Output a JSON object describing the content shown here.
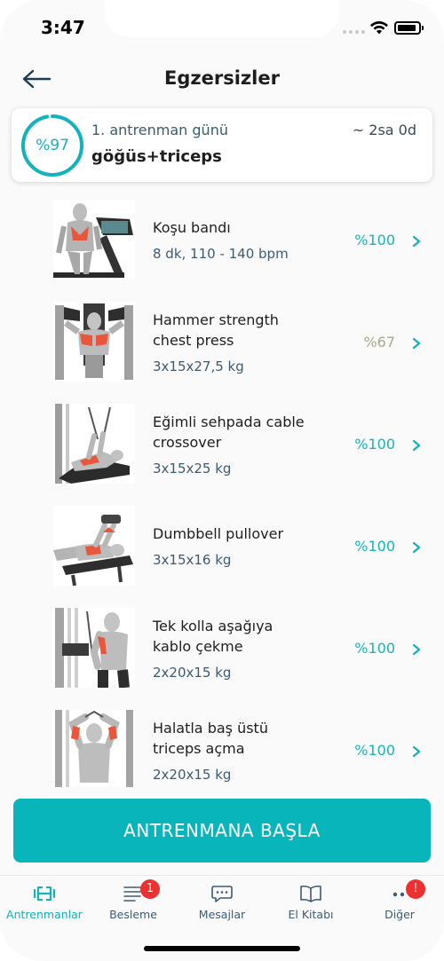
{
  "status_bar": {
    "time": "3:47"
  },
  "header": {
    "title": "Egzersizler"
  },
  "day_card": {
    "progress_label": "%97",
    "progress_value": 0.97,
    "day_label": "1. antrenman günü",
    "duration": "~ 2sa 0d",
    "muscles": "göğüs+triceps"
  },
  "exercises": [
    {
      "name": "Koşu bandı",
      "detail": "8 dk, 110 - 140 bpm",
      "percent": "%100",
      "thumb_icon": "treadmill-icon"
    },
    {
      "name": "Hammer strength chest press",
      "detail": "3x15x27,5 kg",
      "percent": "%67",
      "thumb_icon": "chest-press-icon"
    },
    {
      "name": "Eğimli sehpada cable crossover",
      "detail": "3x15x25 kg",
      "percent": "%100",
      "thumb_icon": "cable-crossover-icon"
    },
    {
      "name": "Dumbbell pullover",
      "detail": "3x15x16 kg",
      "percent": "%100",
      "thumb_icon": "dumbbell-pullover-icon"
    },
    {
      "name": "Tek kolla aşağıya kablo çekme",
      "detail": "2x20x15 kg",
      "percent": "%100",
      "thumb_icon": "cable-pushdown-icon"
    },
    {
      "name": "Halatla baş üstü triceps açma",
      "detail": "2x20x15 kg",
      "percent": "%100",
      "thumb_icon": "rope-overhead-extension-icon"
    }
  ],
  "start_button": {
    "label": "ANTRENMANA BAŞLA"
  },
  "tab_bar": {
    "items": [
      {
        "label": "Antrenmanlar",
        "icon": "dumbbell-icon",
        "active": true
      },
      {
        "label": "Besleme",
        "icon": "feed-list-icon",
        "badge": "1"
      },
      {
        "label": "Mesajlar",
        "icon": "chat-bubble-icon"
      },
      {
        "label": "El Kitabı",
        "icon": "open-book-icon"
      },
      {
        "label": "Diğer",
        "icon": "more-dots-icon",
        "badge": "!"
      }
    ]
  },
  "colors": {
    "accent": "#08b5ba",
    "percent_full": "#16b3b8",
    "percent_partial": "#a9a88a",
    "muscle_highlight": "#e8573c",
    "badge": "#ef3030"
  }
}
